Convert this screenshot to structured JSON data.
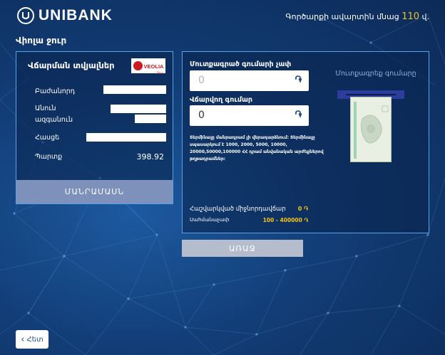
{
  "header": {
    "brand": "UNIBANK",
    "timer_prefix": "Գործարքի ավարտին մնաց",
    "timer_value": "110",
    "timer_unit": "վ."
  },
  "page_title": "Վիոլա ջուր",
  "payment_details": {
    "title": "Վճարման տվյալներ",
    "provider_logo": "VEOLIA",
    "provider_logo_sub": "Ջուր",
    "fields": [
      {
        "label": "Բաժանորդ"
      },
      {
        "label_line1": "Անուն",
        "label_line2": "ազգանուն"
      },
      {
        "label": "Հասցե"
      },
      {
        "label": "Պարտք",
        "value": "398.92"
      }
    ],
    "details_button": "ՄԱՆՐԱՄԱՍՆ"
  },
  "payment_form": {
    "entered_amount_label": "Մուտքագրած գումարի չափ",
    "entered_amount_value": "0",
    "pay_amount_label": "Վճարվող գումար",
    "pay_amount_value": "0",
    "notice": "Տերմինալը մանրադրամ չի վերադարձնում: Տերմինալը սպասարկում է 1000, 2000, 5000, 10000, 20000,50000,100000 ՀՀ դրամ անվանական արժեքներով թղթադրամներ:",
    "calc_label": "Հաշվարկված միջնորդավճար",
    "calc_value": "0 ֏",
    "limit_label": "Սահմանաչափ",
    "limit_value": "100 - 400000 ֏",
    "insert_label": "Մուտքագրեք գումարը"
  },
  "continue_button": "ԱՌԱՋ",
  "back_button": "Հետ",
  "colors": {
    "accent_yellow": "#f2c319",
    "panel_border": "#5aa2e8",
    "button_disabled": "#b5bdcc",
    "details_button": "#7d91bb",
    "background": "#123d76"
  }
}
